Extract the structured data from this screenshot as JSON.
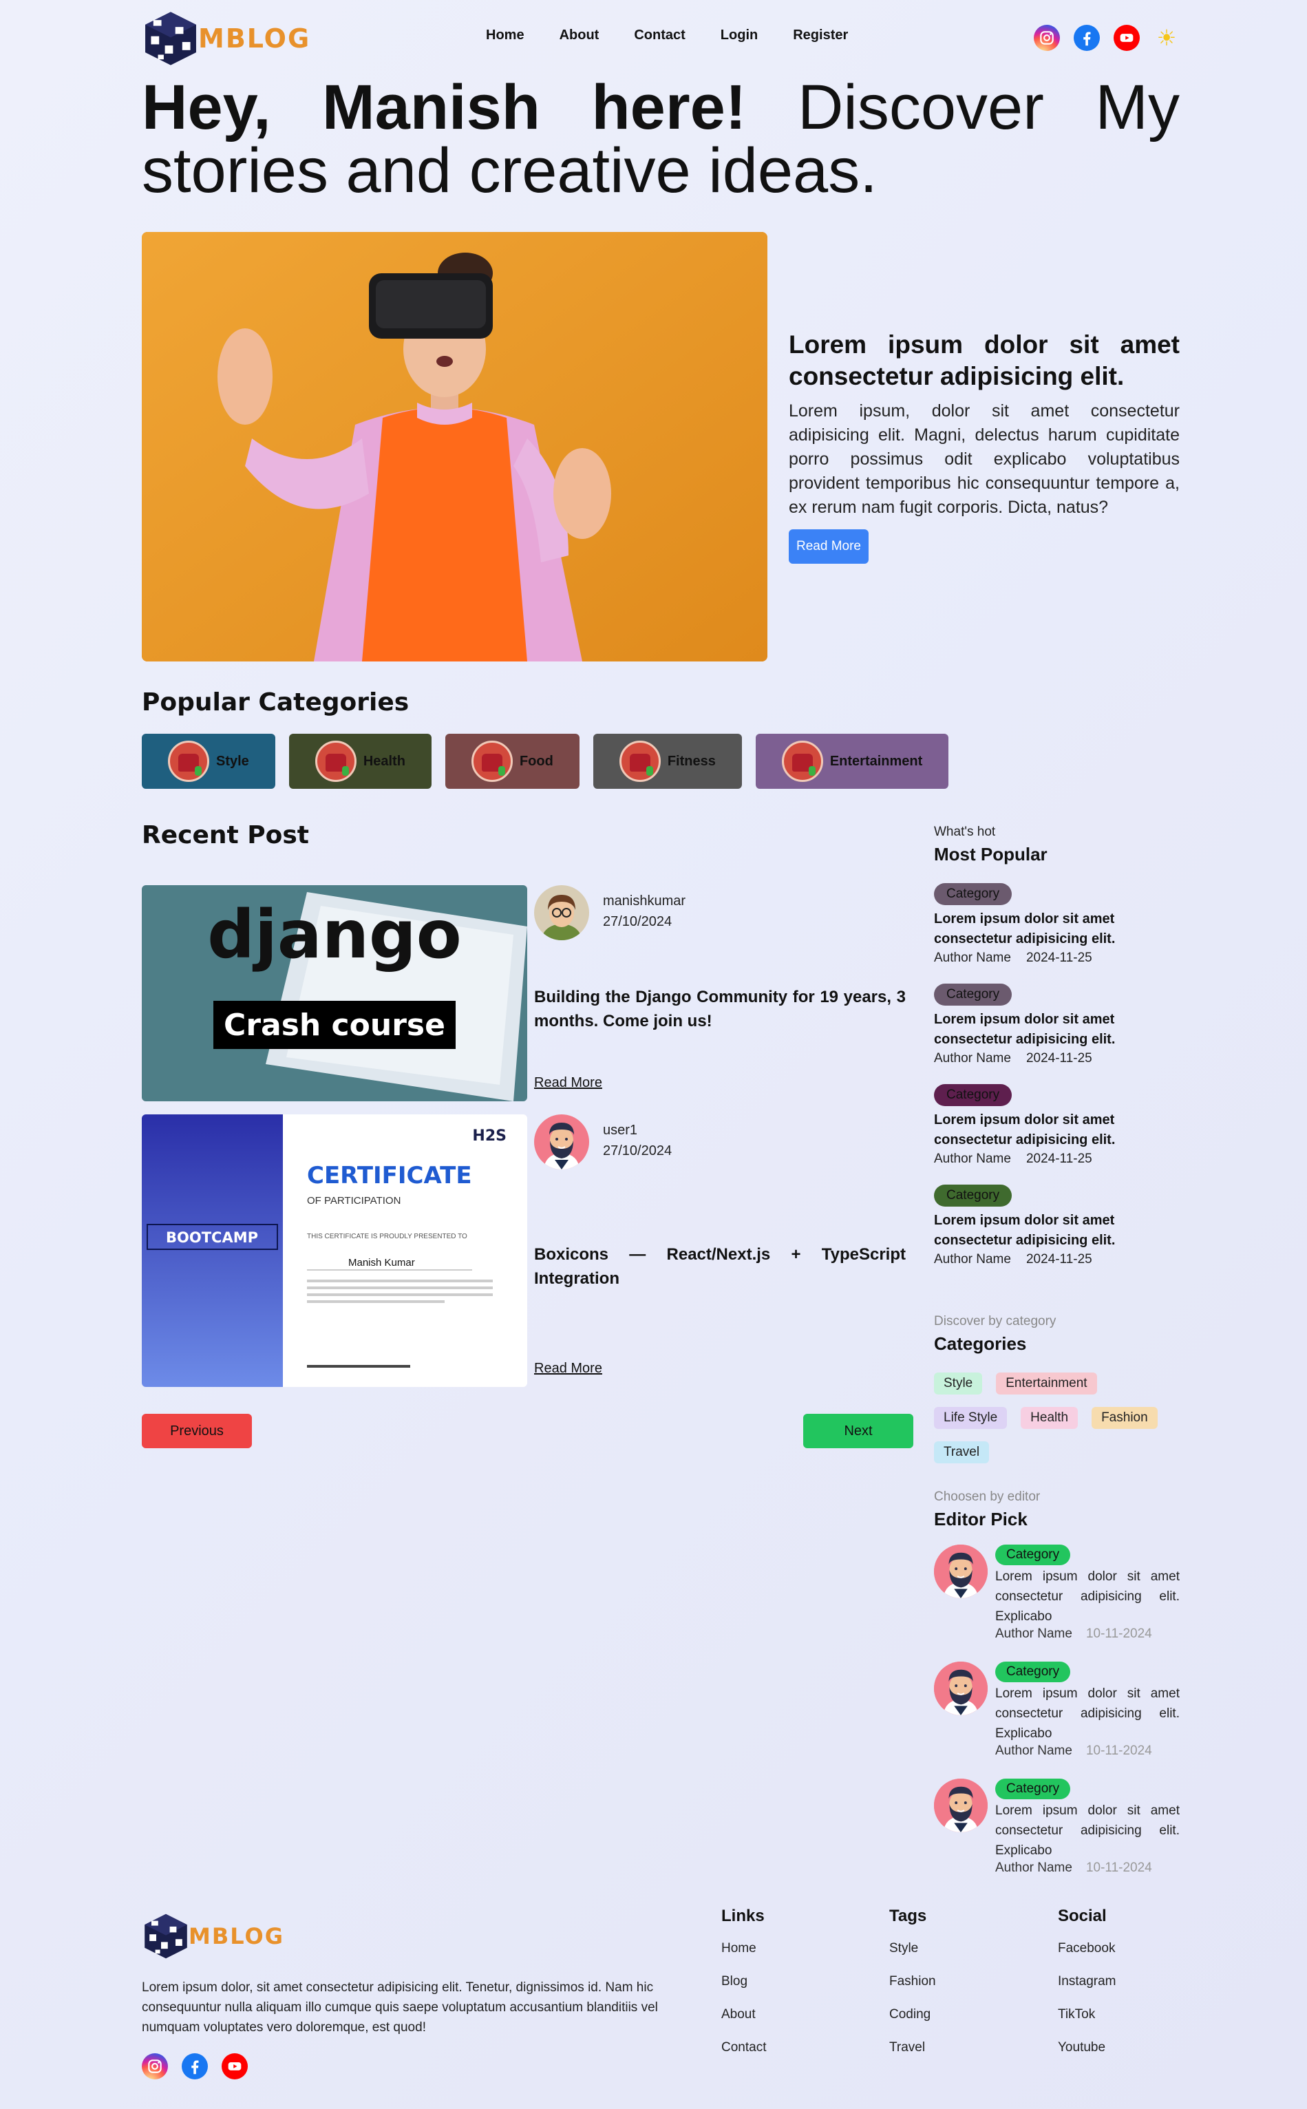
{
  "nav": {
    "logo_text": "MBLOG",
    "links": [
      "Home",
      "About",
      "Contact",
      "Login",
      "Register"
    ]
  },
  "hero": {
    "title_bold": "Hey, Manish here!",
    "title_rest": " Discover My stories and creative ideas.",
    "feature_title": "Lorem ipsum dolor sit amet consectetur adipisicing elit.",
    "feature_body": "Lorem ipsum, dolor sit amet consectetur adipisicing elit. Magni, delectus harum cupiditate porro possimus odit explicabo voluptatibus provident temporibus hic consequuntur tempore a, ex rerum nam fugit corporis. Dicta, natus?",
    "read_more": "Read More"
  },
  "categories": {
    "title": "Popular Categories",
    "items": [
      {
        "label": "Style",
        "color": "#1f5f7f"
      },
      {
        "label": "Health",
        "color": "#3f4a2a"
      },
      {
        "label": "Food",
        "color": "#7a4848"
      },
      {
        "label": "Fitness",
        "color": "#555555"
      },
      {
        "label": "Entertainment",
        "color": "#7d5f92"
      }
    ]
  },
  "recent": {
    "title": "Recent Post",
    "posts": [
      {
        "image_text_1": "django",
        "image_text_2": "Crash course",
        "author": "manishkumar",
        "date": "27/10/2024",
        "title": "Building the Django Community for 19 years, 3 months. Come join us!",
        "read_more": "Read More"
      },
      {
        "image_bootcamp": "BOOTCAMP",
        "image_cert": "CERTIFICATE",
        "image_cert_sub": "OF PARTICIPATION",
        "image_h2s": "H2S",
        "image_presented": "THIS CERTIFICATE IS PROUDLY PRESENTED TO",
        "image_name": "Manish Kumar",
        "author": "user1",
        "date": "27/10/2024",
        "title": "Boxicons — React/Next.js + TypeScript Integration",
        "read_more": "Read More"
      }
    ],
    "prev": "Previous",
    "next": "Next"
  },
  "sidebar": {
    "popular_sub": "What's hot",
    "popular_head": "Most Popular",
    "popular": [
      {
        "badge": "Category",
        "color": "#6b5a6e",
        "title": "Lorem ipsum dolor sit amet consectetur adipisicing elit.",
        "author": "Author Name",
        "date": "2024-11-25"
      },
      {
        "badge": "Category",
        "color": "#6b5a6e",
        "title": "Lorem ipsum dolor sit amet consectetur adipisicing elit.",
        "author": "Author Name",
        "date": "2024-11-25"
      },
      {
        "badge": "Category",
        "color": "#5e1f4e",
        "title": "Lorem ipsum dolor sit amet consectetur adipisicing elit.",
        "author": "Author Name",
        "date": "2024-11-25"
      },
      {
        "badge": "Category",
        "color": "#3f6a2e",
        "title": "Lorem ipsum dolor sit amet consectetur adipisicing elit.",
        "author": "Author Name",
        "date": "2024-11-25"
      }
    ],
    "cat_sub": "Discover by category",
    "cat_head": "Categories",
    "tags": [
      {
        "label": "Style",
        "color": "#c8f2dc"
      },
      {
        "label": "Entertainment",
        "color": "#f7c8cf"
      },
      {
        "label": "Life Style",
        "color": "#ddd3f5"
      },
      {
        "label": "Health",
        "color": "#f7cfe2"
      },
      {
        "label": "Fashion",
        "color": "#f7dcae"
      },
      {
        "label": "Travel",
        "color": "#c5e8f7"
      }
    ],
    "editor_sub": "Choosen by editor",
    "editor_head": "Editor Pick",
    "editor": [
      {
        "badge": "Category",
        "text": "Lorem ipsum dolor sit amet consectetur adipisicing elit. Explicabo",
        "author": "Author Name",
        "date": "10-11-2024"
      },
      {
        "badge": "Category",
        "text": "Lorem ipsum dolor sit amet consectetur adipisicing elit. Explicabo",
        "author": "Author Name",
        "date": "10-11-2024"
      },
      {
        "badge": "Category",
        "text": "Lorem ipsum dolor sit amet consectetur adipisicing elit. Explicabo",
        "author": "Author Name",
        "date": "10-11-2024"
      }
    ]
  },
  "footer": {
    "logo_text": "MBLOG",
    "desc": "Lorem ipsum dolor, sit amet consectetur adipisicing elit. Tenetur, dignissimos id. Nam hic consequuntur nulla aliquam illo cumque quis saepe voluptatum accusantium blanditiis vel numquam voluptates vero doloremque, est quod!",
    "links_head": "Links",
    "links": [
      "Home",
      "Blog",
      "About",
      "Contact"
    ],
    "tags_head": "Tags",
    "tags": [
      "Style",
      "Fashion",
      "Coding",
      "Travel"
    ],
    "social_head": "Social",
    "social": [
      "Facebook",
      "Instagram",
      "TikTok",
      "Youtube"
    ]
  }
}
